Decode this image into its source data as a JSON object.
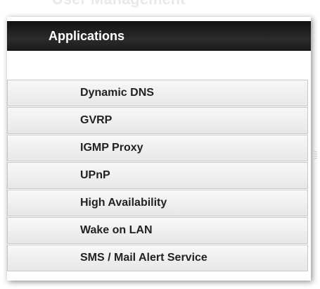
{
  "partial_heading": "User Management",
  "menu": {
    "header": "Applications",
    "items": [
      {
        "label": "Dynamic DNS"
      },
      {
        "label": "GVRP"
      },
      {
        "label": "IGMP Proxy"
      },
      {
        "label": "UPnP"
      },
      {
        "label": "High Availability"
      },
      {
        "label": "Wake on LAN"
      },
      {
        "label": "SMS / Mail Alert Service"
      }
    ]
  }
}
